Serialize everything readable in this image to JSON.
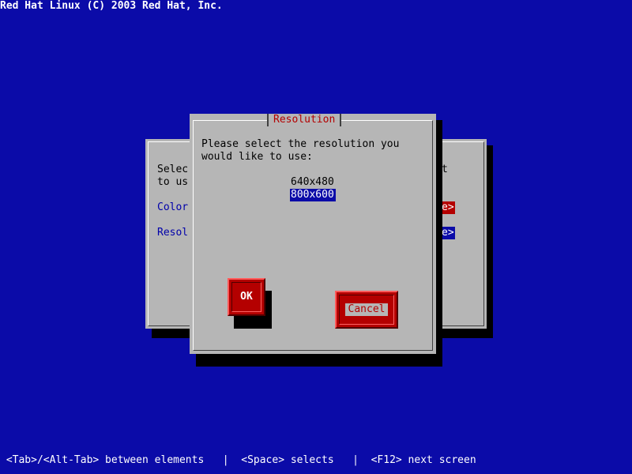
{
  "header": {
    "title": "Red Hat Linux (C) 2003 Red Hat, Inc."
  },
  "background_window": {
    "line1": "Selec",
    "line2": "to us",
    "line1_right": "t",
    "color_label": "Color",
    "resol_label": "Resol",
    "color_button_tail": "e>",
    "resol_button_tail": "e>"
  },
  "dialog": {
    "title": "Resolution",
    "prompt_line1": "Please select the resolution you",
    "prompt_line2": "would like to use:",
    "resolutions": [
      "640x480",
      "800x600"
    ],
    "selected_index": 1,
    "ok_label": "OK",
    "cancel_label": "Cancel"
  },
  "footer": {
    "help": " <Tab>/<Alt-Tab> between elements   |  <Space> selects   |  <F12> next screen"
  },
  "colors": {
    "background": "#0b0ba8",
    "window": "#b6b6b6",
    "button": "#b40000",
    "title_text": "#b40000",
    "selection": "#0b0ba8"
  }
}
